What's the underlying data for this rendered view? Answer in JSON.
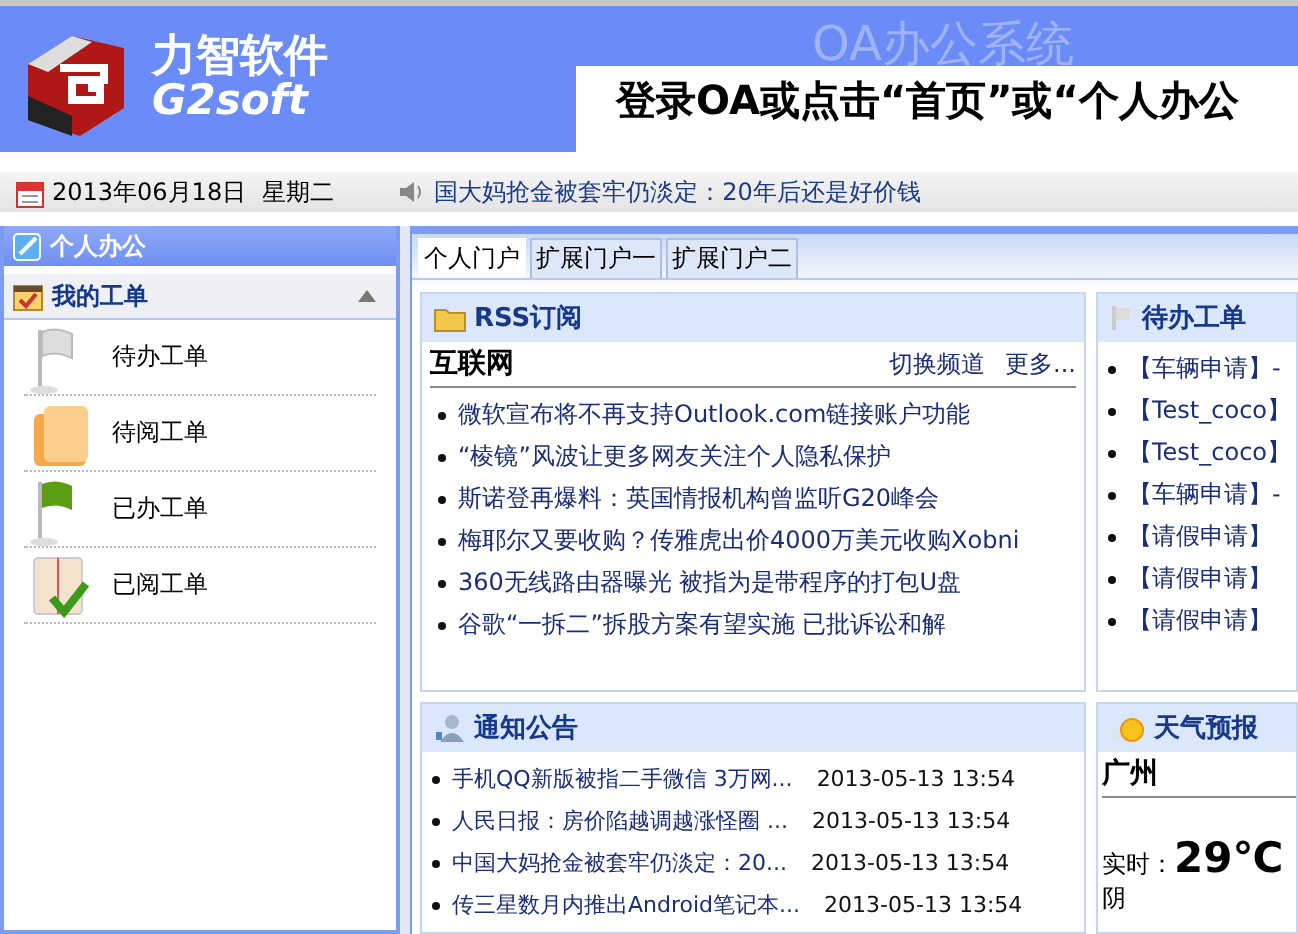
{
  "header": {
    "logo_title": "力智软件",
    "logo_subtitle": "G2soft",
    "system_name": "OA办公系统",
    "banner": "登录OA或点击“首页”或“个人办公"
  },
  "info_bar": {
    "date": "2013年06月18日",
    "weekday": "星期二",
    "news_ticker": "国大妈抢金被套牢仍淡定：20年后还是好价钱"
  },
  "sidebar": {
    "title": "个人办公",
    "section": {
      "title": "我的工单",
      "expanded": true,
      "items": [
        {
          "label": "待办工单",
          "kind": "pending"
        },
        {
          "label": "待阅工单",
          "kind": "unread"
        },
        {
          "label": "已办工单",
          "kind": "done"
        },
        {
          "label": "已阅工单",
          "kind": "read"
        }
      ]
    }
  },
  "tabs": [
    {
      "label": "个人门户",
      "selected": true
    },
    {
      "label": "扩展门户一",
      "selected": false
    },
    {
      "label": "扩展门户二",
      "selected": false
    }
  ],
  "rss": {
    "title": "RSS订阅",
    "channel": "互联网",
    "actions": [
      "切换频道",
      "更多..."
    ],
    "items": [
      "微软宣布将不再支持Outlook.com链接账户功能",
      "“棱镜”风波让更多网友关注个人隐私保护",
      "斯诺登再爆料：英国情报机构曾监听G20峰会",
      "梅耶尔又要收购？传雅虎出价4000万美元收购Xobni",
      "360无线路由器曝光 被指为是带程序的打包U盘",
      "谷歌“一拆二”拆股方案有望实施 已批诉讼和解"
    ]
  },
  "notices": {
    "title": "通知公告",
    "items": [
      {
        "title": "手机QQ新版被指二手微信 3万网...",
        "time": "2013-05-13 13:54"
      },
      {
        "title": "人民日报：房价陷越调越涨怪圈 ...",
        "time": "2013-05-13 13:54"
      },
      {
        "title": "中国大妈抢金被套牢仍淡定：20...",
        "time": "2013-05-13 13:54"
      },
      {
        "title": "传三星数月内推出Android笔记本...",
        "time": "2013-05-13 13:54"
      }
    ]
  },
  "todo": {
    "title": "待办工单",
    "items": [
      "【车辆申请】-",
      "【Test_coco】",
      "【Test_coco】",
      "【车辆申请】-",
      "【请假申请】",
      "【请假申请】",
      "【请假申请】"
    ]
  },
  "weather": {
    "title": "天气预报",
    "city": "广州",
    "label": "实时：",
    "temperature": "29℃",
    "condition": "阴"
  }
}
